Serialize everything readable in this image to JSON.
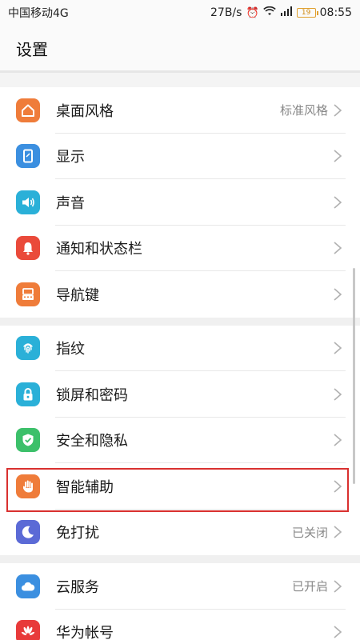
{
  "status_bar": {
    "carrier": "中国移动4G",
    "speed": "27B/s",
    "battery": "19",
    "time": "08:55"
  },
  "header": {
    "title": "设置"
  },
  "groups": [
    {
      "items": [
        {
          "label": "桌面风格",
          "value": "标准风格",
          "icon": "home-icon",
          "color": "#ef7c3a"
        },
        {
          "label": "显示",
          "value": "",
          "icon": "display-icon",
          "color": "#3b8fe0"
        },
        {
          "label": "声音",
          "value": "",
          "icon": "speaker-icon",
          "color": "#2ab0d8"
        },
        {
          "label": "通知和状态栏",
          "value": "",
          "icon": "bell-icon",
          "color": "#ea4a3a"
        },
        {
          "label": "导航键",
          "value": "",
          "icon": "keyboard-icon",
          "color": "#ef7c3a"
        }
      ]
    },
    {
      "items": [
        {
          "label": "指纹",
          "value": "",
          "icon": "fingerprint-icon",
          "color": "#2ab0d8"
        },
        {
          "label": "锁屏和密码",
          "value": "",
          "icon": "lock-icon",
          "color": "#2ab0d8"
        },
        {
          "label": "安全和隐私",
          "value": "",
          "icon": "shield-icon",
          "color": "#3cc06a"
        },
        {
          "label": "智能辅助",
          "value": "",
          "icon": "hand-icon",
          "color": "#ef7c3a"
        },
        {
          "label": "免打扰",
          "value": "已关闭",
          "icon": "moon-icon",
          "color": "#5b6ad6"
        }
      ]
    },
    {
      "items": [
        {
          "label": "云服务",
          "value": "已开启",
          "icon": "cloud-icon",
          "color": "#3b8fe0"
        },
        {
          "label": "华为帐号",
          "value": "",
          "icon": "huawei-icon",
          "color": "#e83a3a"
        }
      ]
    }
  ]
}
